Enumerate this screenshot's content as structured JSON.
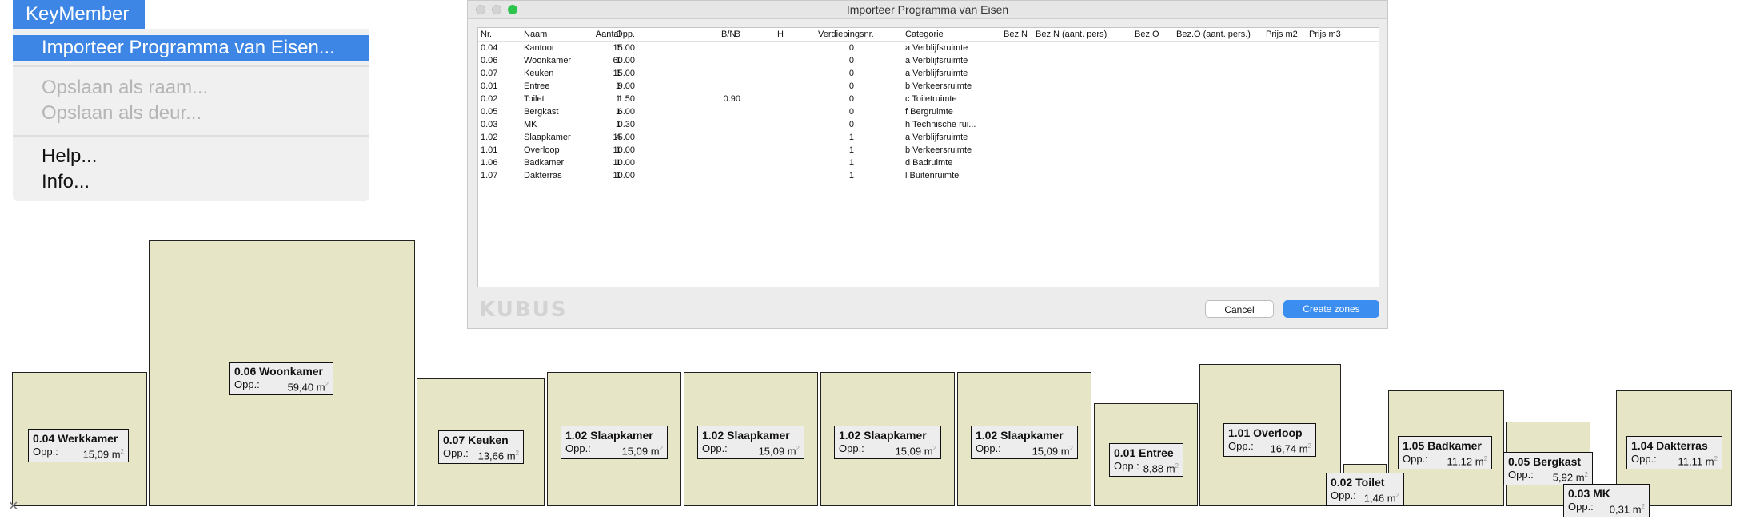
{
  "menu": {
    "title": "KeyMember",
    "items": [
      {
        "label": "Importeer Programma van Eisen...",
        "state": "active"
      },
      {
        "label": "Opslaan als raam...",
        "state": "disabled"
      },
      {
        "label": "Opslaan als deur...",
        "state": "disabled"
      },
      {
        "label": "Help...",
        "state": "normal"
      },
      {
        "label": "Info...",
        "state": "normal"
      }
    ]
  },
  "dialog": {
    "title": "Importeer Programma van Eisen",
    "columns": [
      "Nr.",
      "Naam",
      "Aantal",
      "Opp.",
      "B/N",
      "B",
      "H",
      "Verdiepingsnr.",
      "Categorie",
      "Bez.N",
      "Bez.N (aant. pers)",
      "Bez.O",
      "Bez.O (aant. pers.)",
      "Prijs m2",
      "Prijs m3"
    ],
    "rows": [
      {
        "nr": "0.04",
        "naam": "Kantoor",
        "aantal": "1",
        "opp": "15.00",
        "b": "",
        "verd": "0",
        "cat": "a Verblijfsruimte"
      },
      {
        "nr": "0.06",
        "naam": "Woonkamer",
        "aantal": "1",
        "opp": "60.00",
        "b": "",
        "verd": "0",
        "cat": "a Verblijfsruimte"
      },
      {
        "nr": "0.07",
        "naam": "Keuken",
        "aantal": "1",
        "opp": "15.00",
        "b": "",
        "verd": "0",
        "cat": "a Verblijfsruimte"
      },
      {
        "nr": "0.01",
        "naam": "Entree",
        "aantal": "1",
        "opp": "9.00",
        "b": "",
        "verd": "0",
        "cat": "b Verkeersruimte"
      },
      {
        "nr": "0.02",
        "naam": "Toilet",
        "aantal": "1",
        "opp": "1.50",
        "b": "0.90",
        "verd": "0",
        "cat": "c Toiletruimte"
      },
      {
        "nr": "0.05",
        "naam": "Bergkast",
        "aantal": "1",
        "opp": "6.00",
        "b": "",
        "verd": "0",
        "cat": "f Bergruimte"
      },
      {
        "nr": "0.03",
        "naam": "MK",
        "aantal": "1",
        "opp": "0.30",
        "b": "",
        "verd": "0",
        "cat": "h Technische rui..."
      },
      {
        "nr": "1.02",
        "naam": "Slaapkamer",
        "aantal": "4",
        "opp": "15.00",
        "b": "",
        "verd": "1",
        "cat": "a Verblijfsruimte"
      },
      {
        "nr": "1.01",
        "naam": "Overloop",
        "aantal": "1",
        "opp": "10.00",
        "b": "",
        "verd": "1",
        "cat": "b Verkeersruimte"
      },
      {
        "nr": "1.06",
        "naam": "Badkamer",
        "aantal": "1",
        "opp": "10.00",
        "b": "",
        "verd": "1",
        "cat": "d Badruimte"
      },
      {
        "nr": "1.07",
        "naam": "Dakterras",
        "aantal": "1",
        "opp": "10.00",
        "b": "",
        "verd": "1",
        "cat": "l Buitenruimte"
      }
    ],
    "watermark": "KUBUS",
    "cancel_label": "Cancel",
    "create_label": "Create zones"
  },
  "zones": [
    {
      "name": "0.04 Werkkamer",
      "label": "Opp.:",
      "value": "15,09 m",
      "unit_sup": "2"
    },
    {
      "name": "0.06 Woonkamer",
      "label": "Opp.:",
      "value": "59,40 m",
      "unit_sup": "2"
    },
    {
      "name": "0.07 Keuken",
      "label": "Opp.:",
      "value": "13,66 m",
      "unit_sup": "2"
    },
    {
      "name": "1.02 Slaapkamer",
      "label": "Opp.:",
      "value": "15,09 m",
      "unit_sup": "2"
    },
    {
      "name": "1.02 Slaapkamer",
      "label": "Opp.:",
      "value": "15,09 m",
      "unit_sup": "2"
    },
    {
      "name": "1.02 Slaapkamer",
      "label": "Opp.:",
      "value": "15,09 m",
      "unit_sup": "2"
    },
    {
      "name": "1.02 Slaapkamer",
      "label": "Opp.:",
      "value": "15,09 m",
      "unit_sup": "2"
    },
    {
      "name": "0.01 Entree",
      "label": "Opp.:",
      "value": "8,88 m",
      "unit_sup": "2"
    },
    {
      "name": "1.01 Overloop",
      "label": "Opp.:",
      "value": "16,74 m",
      "unit_sup": "2"
    },
    {
      "name": "0.02 Toilet",
      "label": "Opp.:",
      "value": "1,46 m",
      "unit_sup": "2"
    },
    {
      "name": "1.05 Badkamer",
      "label": "Opp.:",
      "value": "11,12 m",
      "unit_sup": "2"
    },
    {
      "name": "0.05 Bergkast",
      "label": "Opp.:",
      "value": "5,92 m",
      "unit_sup": "2"
    },
    {
      "name": "0.03 MK",
      "label": "Opp.:",
      "value": "0,31 m",
      "unit_sup": "2"
    },
    {
      "name": "1.04 Dakterras",
      "label": "Opp.:",
      "value": "11,11 m",
      "unit_sup": "2"
    }
  ],
  "colors": {
    "accent": "#3d86e6",
    "zone_fill": "#e6e6c7",
    "create_button": "#3b8ef0"
  },
  "close_icon": "close-icon"
}
